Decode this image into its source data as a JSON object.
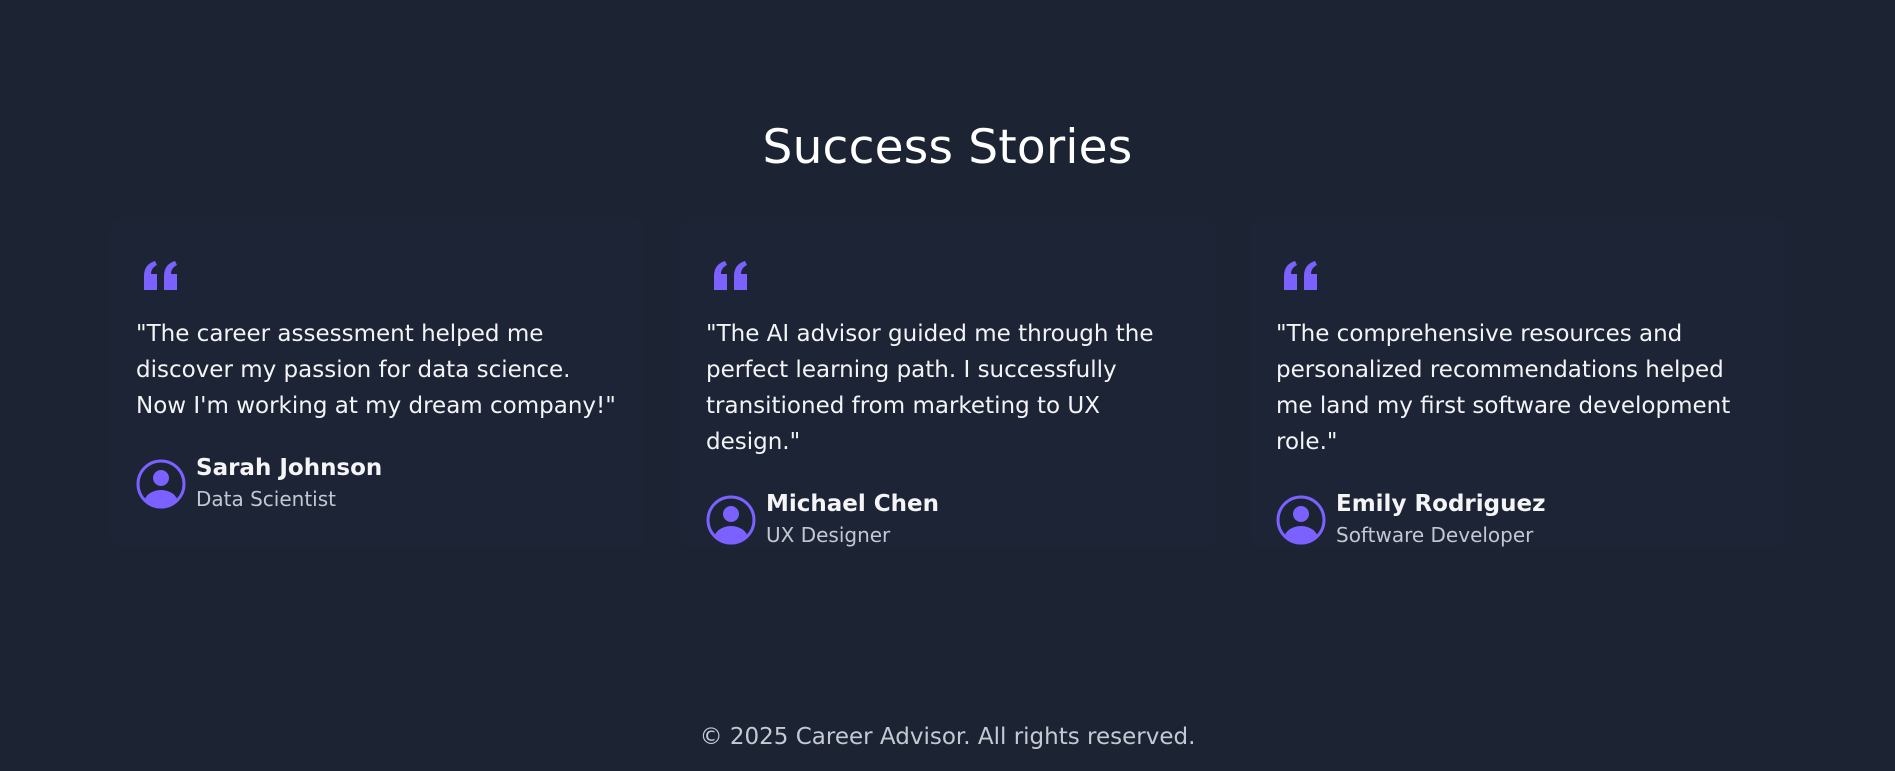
{
  "section": {
    "title": "Success Stories"
  },
  "colors": {
    "background": "#1c2333",
    "accent": "#7b61ff",
    "text": "#ffffff",
    "muted": "#c3c7d1"
  },
  "testimonials": [
    {
      "quote": "\"The career assessment helped me discover my passion for data science. Now I'm working at my dream company!\"",
      "name": "Sarah Johnson",
      "role": "Data Scientist",
      "icon": "quote-icon",
      "avatar_icon": "user-avatar-icon"
    },
    {
      "quote": "\"The AI advisor guided me through the perfect learning path. I successfully transitioned from marketing to UX design.\"",
      "name": "Michael Chen",
      "role": "UX Designer",
      "icon": "quote-icon",
      "avatar_icon": "user-avatar-icon"
    },
    {
      "quote": "\"The comprehensive resources and personalized recommendations helped me land my first software development role.\"",
      "name": "Emily Rodriguez",
      "role": "Software Developer",
      "icon": "quote-icon",
      "avatar_icon": "user-avatar-icon"
    }
  ],
  "footer": {
    "copyright": "© 2025 Career Advisor. All rights reserved."
  }
}
